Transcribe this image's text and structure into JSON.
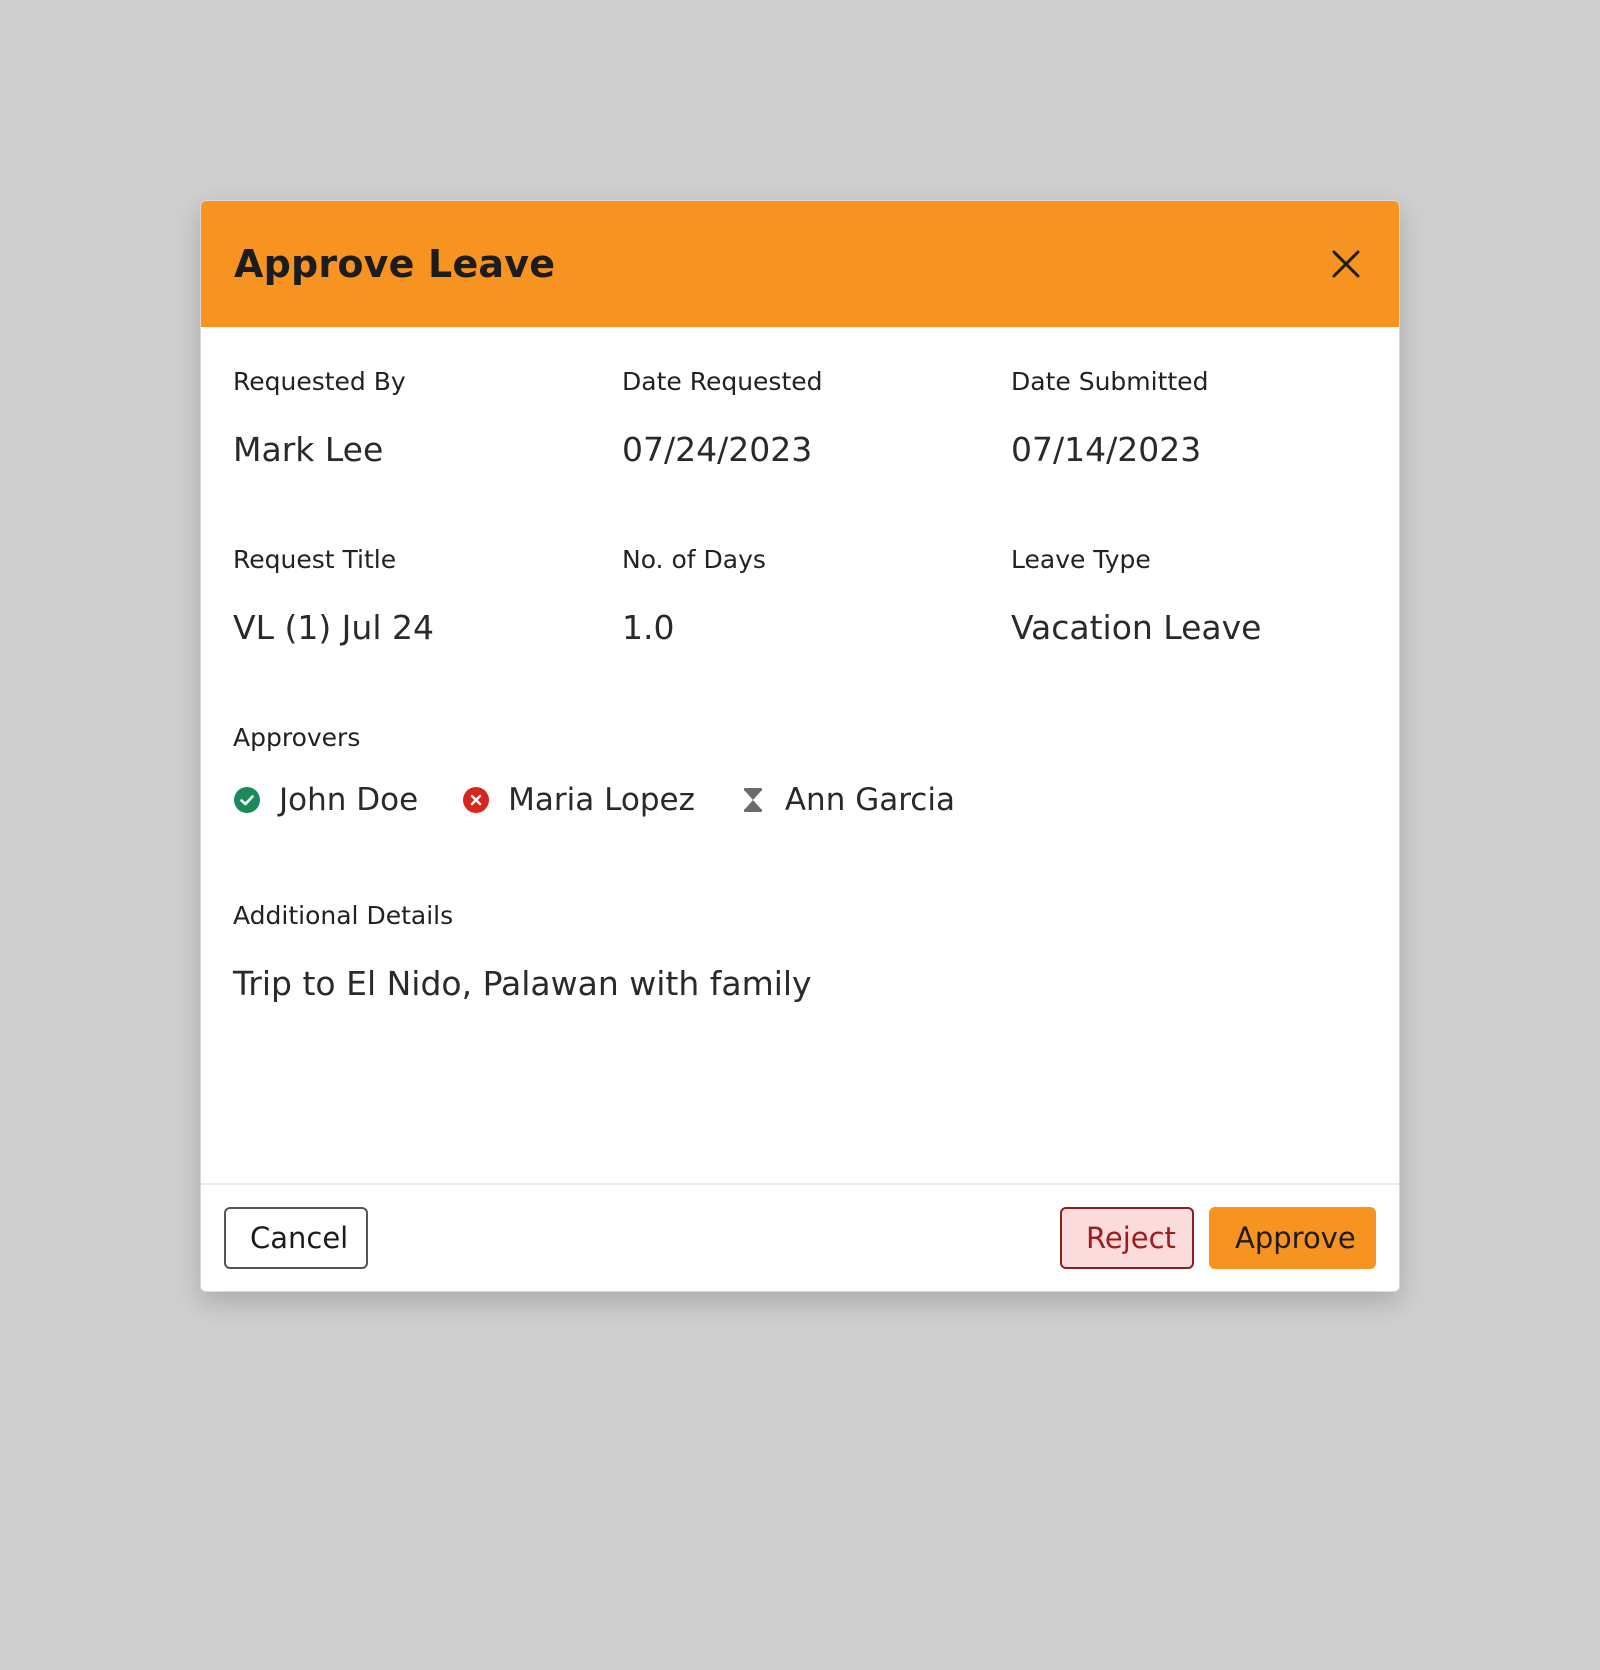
{
  "modal": {
    "title": "Approve Leave"
  },
  "fields": {
    "requested_by": {
      "label": "Requested By",
      "value": "Mark Lee"
    },
    "date_requested": {
      "label": "Date Requested",
      "value": "07/24/2023"
    },
    "date_submitted": {
      "label": "Date Submitted",
      "value": "07/14/2023"
    },
    "request_title": {
      "label": "Request Title",
      "value": "VL (1) Jul 24"
    },
    "no_of_days": {
      "label": "No. of Days",
      "value": "1.0"
    },
    "leave_type": {
      "label": "Leave Type",
      "value": "Vacation Leave"
    }
  },
  "approvers": {
    "label": "Approvers",
    "items": [
      {
        "name": "John Doe",
        "status": "approved",
        "icon": "check-circle-icon",
        "color": "#1b8a5a"
      },
      {
        "name": "Maria Lopez",
        "status": "rejected",
        "icon": "x-circle-icon",
        "color": "#d9261c"
      },
      {
        "name": "Ann Garcia",
        "status": "pending",
        "icon": "hourglass-icon",
        "color": "#6b6b6b"
      }
    ]
  },
  "details": {
    "label": "Additional Details",
    "value": "Trip to El Nido, Palawan with family"
  },
  "footer": {
    "cancel_label": "Cancel",
    "reject_label": "Reject",
    "approve_label": "Approve"
  },
  "colors": {
    "accent": "#f69321",
    "reject_bg": "#fbdcdc",
    "reject_border": "#8a2020",
    "reject_text": "#a01c1c",
    "approved": "#1b8a5a",
    "rejected": "#d9261c",
    "pending": "#6b6b6b"
  }
}
